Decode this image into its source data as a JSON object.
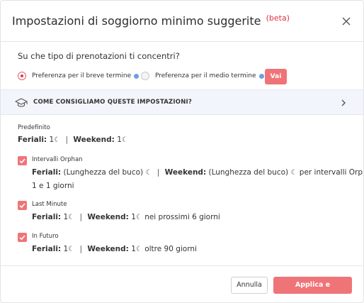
{
  "dialog": {
    "title": "Impostazioni di soggiorno minimo suggerite",
    "beta": "(beta)"
  },
  "booking_type": {
    "question": "Su che tipo di prenotazioni ti concentri?",
    "options": [
      {
        "label": "Preferenza per il breve termine",
        "selected": true
      },
      {
        "label": "Preferenza per il medio termine",
        "selected": false
      }
    ],
    "go_label": "Vai"
  },
  "advice": {
    "label": "COME CONSIGLIAMO QUESTE IMPOSTAZIONI?"
  },
  "defaults": {
    "label": "Predefinito",
    "weekdays_label": "Feriali:",
    "weekdays_value": "1",
    "weekend_label": "Weekend:",
    "weekend_value": "1"
  },
  "orphan": {
    "label": "Intervalli Orphan",
    "checked": true,
    "weekdays_label": "Feriali:",
    "weekdays_value": "(Lunghezza del buco)",
    "weekend_label": "Weekend:",
    "weekend_value": "(Lunghezza del buco)",
    "suffix": "per intervalli Orphan tra",
    "suffix2": "1 e 1 giorni"
  },
  "last_minute": {
    "label": "Last Minute",
    "checked": true,
    "weekdays_label": "Feriali:",
    "weekdays_value": "1",
    "weekend_label": "Weekend:",
    "weekend_value": "1",
    "suffix": "nei prossimi 6 giorni"
  },
  "future": {
    "label": "In Futuro",
    "checked": true,
    "weekdays_label": "Feriali:",
    "weekdays_value": "1",
    "weekend_label": "Weekend:",
    "weekend_value": "1",
    "suffix": "oltre 90 giorni"
  },
  "footer": {
    "cancel_label": "Annulla",
    "apply_label": "Applica e personalizza"
  },
  "colors": {
    "accent": "#ef7478",
    "beta": "#e0313f",
    "info": "#6f9de0",
    "advice_bg": "#f2f5fb"
  },
  "glyphs": {
    "moon": "☾",
    "separator": "|"
  }
}
